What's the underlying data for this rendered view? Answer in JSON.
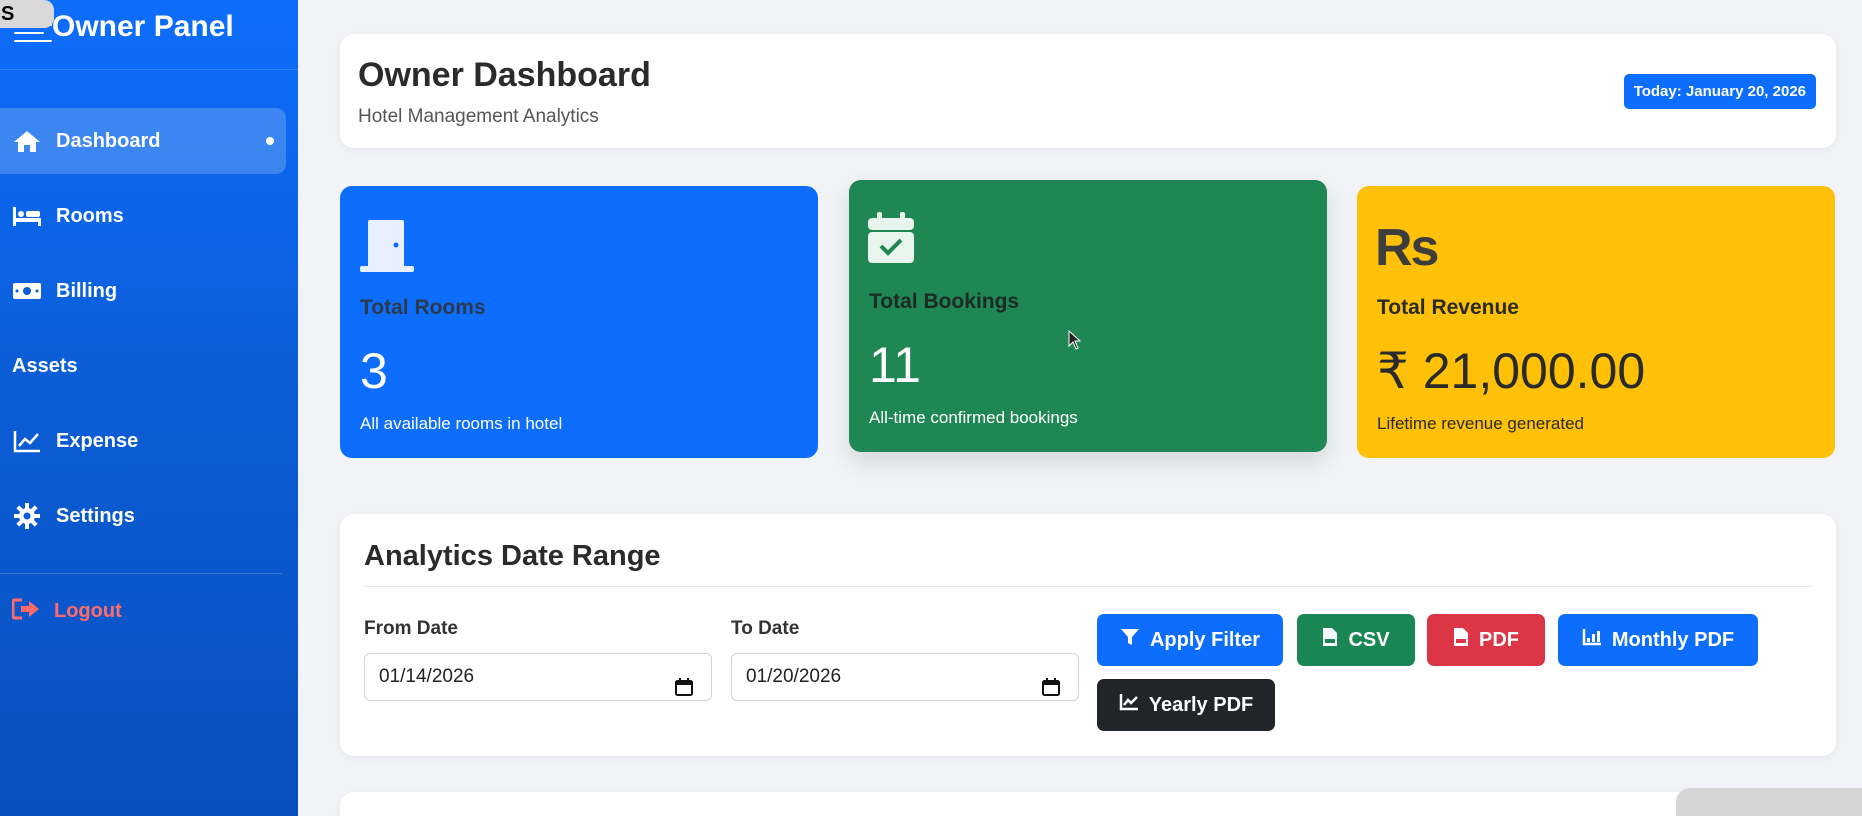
{
  "sidebar": {
    "overlay_label": "S",
    "title": "Owner Panel",
    "items": [
      {
        "label": "Dashboard",
        "icon": "home-icon",
        "active": true
      },
      {
        "label": "Rooms",
        "icon": "bed-icon"
      },
      {
        "label": "Billing",
        "icon": "money-bill-icon"
      },
      {
        "label": "Assets",
        "icon": ""
      },
      {
        "label": "Expense",
        "icon": "chart-line-icon"
      },
      {
        "label": "Settings",
        "icon": "gear-icon"
      }
    ],
    "logout_label": "Logout"
  },
  "header": {
    "title": "Owner Dashboard",
    "subtitle": "Hotel Management Analytics",
    "date_badge": "Today: January 20, 2026"
  },
  "stats": [
    {
      "label": "Total Rooms",
      "value": "3",
      "desc": "All available rooms in hotel",
      "icon": "door-icon",
      "color": "#0d6efd"
    },
    {
      "label": "Total Bookings",
      "value": "11",
      "desc": "All-time confirmed bookings",
      "icon": "calendar-check-icon",
      "color": "#1e8754"
    },
    {
      "label": "Total Revenue",
      "value": "₹ 21,000.00",
      "desc": "Lifetime revenue generated",
      "icon": "rupee-sign-icon",
      "icon_text": "Rs",
      "color": "#ffc107"
    }
  ],
  "filter": {
    "title": "Analytics Date Range",
    "from_label": "From Date",
    "from_value": "01/14/2026",
    "to_label": "To Date",
    "to_value": "01/20/2026",
    "buttons": {
      "apply": "Apply Filter",
      "csv": "CSV",
      "pdf": "PDF",
      "monthly_pdf": "Monthly PDF",
      "yearly_pdf": "Yearly PDF"
    }
  }
}
